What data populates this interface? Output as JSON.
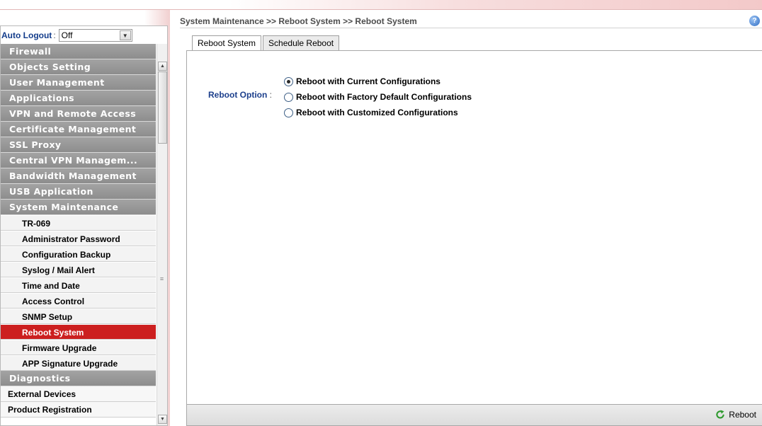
{
  "sidebar": {
    "auto_logout": {
      "label": "Auto Logout",
      "colon": ":",
      "value": "Off"
    },
    "menu": [
      {
        "label": "Firewall",
        "kind": "gray",
        "name": "menu-firewall"
      },
      {
        "label": "Objects Setting",
        "kind": "gray",
        "name": "menu-objects-setting"
      },
      {
        "label": "User Management",
        "kind": "gray",
        "name": "menu-user-management"
      },
      {
        "label": "Applications",
        "kind": "gray",
        "name": "menu-applications"
      },
      {
        "label": "VPN and Remote Access",
        "kind": "gray",
        "name": "menu-vpn-remote-access"
      },
      {
        "label": "Certificate Management",
        "kind": "gray",
        "name": "menu-certificate-management"
      },
      {
        "label": "SSL Proxy",
        "kind": "gray",
        "name": "menu-ssl-proxy"
      },
      {
        "label": "Central VPN Managem...",
        "kind": "gray",
        "name": "menu-central-vpn-management"
      },
      {
        "label": "Bandwidth Management",
        "kind": "gray",
        "name": "menu-bandwidth-management"
      },
      {
        "label": "USB Application",
        "kind": "gray",
        "name": "menu-usb-application"
      },
      {
        "label": "System Maintenance",
        "kind": "gray",
        "name": "menu-system-maintenance"
      },
      {
        "label": "TR-069",
        "kind": "sub",
        "name": "submenu-tr-069"
      },
      {
        "label": "Administrator Password",
        "kind": "sub",
        "name": "submenu-administrator-password"
      },
      {
        "label": "Configuration Backup",
        "kind": "sub",
        "name": "submenu-configuration-backup"
      },
      {
        "label": "Syslog / Mail Alert",
        "kind": "sub",
        "name": "submenu-syslog-mail-alert"
      },
      {
        "label": "Time and Date",
        "kind": "sub",
        "name": "submenu-time-and-date"
      },
      {
        "label": "Access Control",
        "kind": "sub",
        "name": "submenu-access-control"
      },
      {
        "label": "SNMP Setup",
        "kind": "sub",
        "name": "submenu-snmp-setup"
      },
      {
        "label": "Reboot System",
        "kind": "sub",
        "active": true,
        "name": "submenu-reboot-system"
      },
      {
        "label": "Firmware Upgrade",
        "kind": "sub",
        "name": "submenu-firmware-upgrade"
      },
      {
        "label": "APP Signature Upgrade",
        "kind": "sub",
        "name": "submenu-app-signature-upgrade"
      },
      {
        "label": "Diagnostics",
        "kind": "gray",
        "name": "menu-diagnostics"
      },
      {
        "label": "External Devices",
        "kind": "white",
        "name": "menu-external-devices"
      },
      {
        "label": "Product Registration",
        "kind": "white",
        "name": "menu-product-registration"
      }
    ]
  },
  "header": {
    "breadcrumb": "System Maintenance >> Reboot System >> Reboot System",
    "help_glyph": "?"
  },
  "tabs": [
    {
      "label": "Reboot System",
      "active": true
    },
    {
      "label": "Schedule Reboot",
      "active": false
    }
  ],
  "form": {
    "option_label": "Reboot Option",
    "option_colon": " :",
    "options": [
      {
        "label": "Reboot with Current Configurations",
        "checked": true
      },
      {
        "label": "Reboot with Factory Default Configurations",
        "checked": false
      },
      {
        "label": "Reboot with Customized Configurations",
        "checked": false
      }
    ]
  },
  "footer": {
    "reboot_label": "Reboot",
    "reboot_icon_color": "#2e9a2e"
  },
  "colors": {
    "active_menu": "#cc1f1f",
    "gray_menu": "#999999",
    "label_blue": "#1c3f8c"
  }
}
